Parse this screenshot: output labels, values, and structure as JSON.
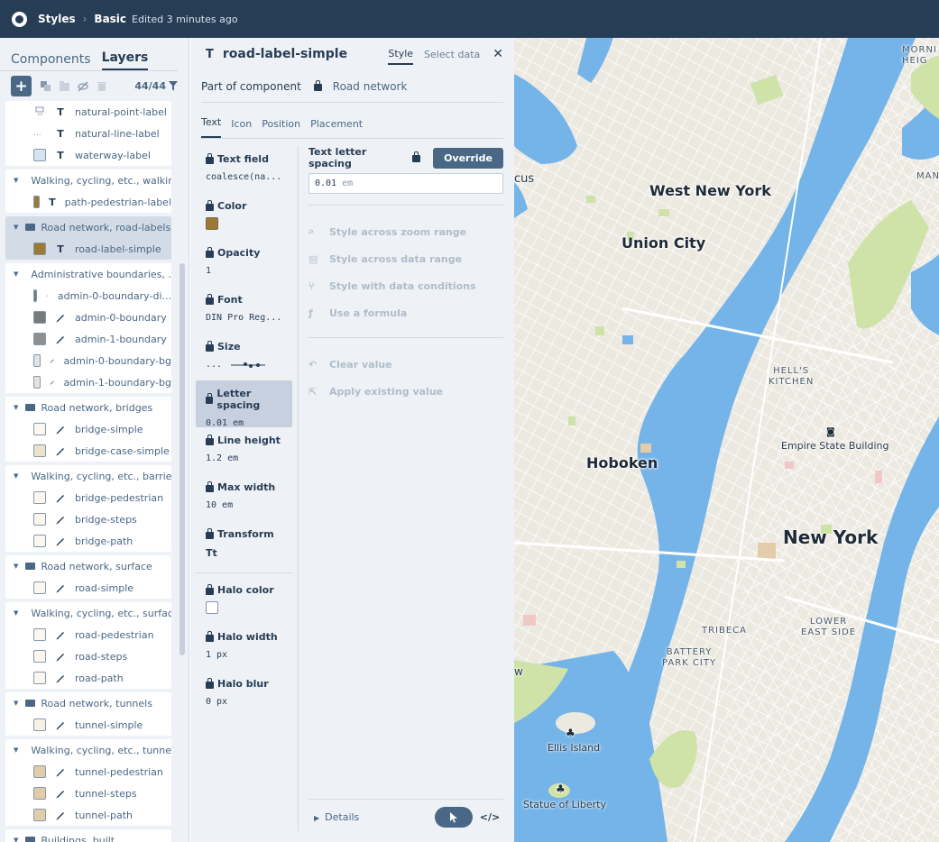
{
  "topbar": {
    "crumb_styles": "Styles",
    "crumb_style": "Basic",
    "edited": "Edited 3 minutes ago"
  },
  "left": {
    "tab_components": "Components",
    "tab_layers": "Layers",
    "count": "44/44",
    "items_top": [
      {
        "name": "natural-point-label",
        "icon": "text-icon"
      },
      {
        "name": "natural-line-label",
        "icon": "text-icon"
      },
      {
        "name": "waterway-label",
        "icon": "text-icon",
        "swatch": "#d6e4f1"
      }
    ],
    "groups": [
      {
        "name": "Walking, cycling, etc., walkin...",
        "layers": [
          {
            "name": "path-pedestrian-label",
            "swatch": "#9c7a33",
            "icon": "text-icon"
          }
        ]
      },
      {
        "name": "Road network, road-labels",
        "selected": true,
        "layers": [
          {
            "name": "road-label-simple",
            "swatch": "#9c7a33",
            "icon": "text-icon"
          }
        ]
      },
      {
        "name": "Administrative boundaries, ...",
        "layers": [
          {
            "name": "admin-0-boundary-di...",
            "swatch": "#7a7a7a",
            "icon": "pencil-icon"
          },
          {
            "name": "admin-0-boundary",
            "swatch": "#7a7a7a",
            "icon": "pencil-icon"
          },
          {
            "name": "admin-1-boundary",
            "swatch": "#8f8f8f",
            "icon": "pencil-icon"
          },
          {
            "name": "admin-0-boundary-bg",
            "swatch": "#e3e3e3",
            "icon": "pencil-icon"
          },
          {
            "name": "admin-1-boundary-bg",
            "swatch": "#e7e1d6",
            "icon": "pencil-icon"
          }
        ]
      },
      {
        "name": "Road network, bridges",
        "layers": [
          {
            "name": "bridge-simple",
            "swatch": "#fbf7ee",
            "icon": "pencil-icon"
          },
          {
            "name": "bridge-case-simple",
            "swatch": "#ede3cc",
            "icon": "pencil-icon"
          }
        ]
      },
      {
        "name": "Walking, cycling, etc., barrier...",
        "layers": [
          {
            "name": "bridge-pedestrian",
            "swatch": "#fbf7ee",
            "icon": "pencil-icon"
          },
          {
            "name": "bridge-steps",
            "swatch": "#fbf7ee",
            "icon": "pencil-icon"
          },
          {
            "name": "bridge-path",
            "swatch": "#fbf7ee",
            "icon": "pencil-icon"
          }
        ]
      },
      {
        "name": "Road network, surface",
        "layers": [
          {
            "name": "road-simple",
            "swatch": "#fbf7ee",
            "icon": "pencil-icon"
          }
        ]
      },
      {
        "name": "Walking, cycling, etc., surface",
        "layers": [
          {
            "name": "road-pedestrian",
            "swatch": "#fbf7ee",
            "icon": "pencil-icon"
          },
          {
            "name": "road-steps",
            "swatch": "#fbf7ee",
            "icon": "pencil-icon"
          },
          {
            "name": "road-path",
            "swatch": "#fbf7ee",
            "icon": "pencil-icon"
          }
        ]
      },
      {
        "name": "Road network, tunnels",
        "layers": [
          {
            "name": "tunnel-simple",
            "swatch": "#f8f1e3",
            "icon": "pencil-icon"
          }
        ]
      },
      {
        "name": "Walking, cycling, etc., tunnels",
        "layers": [
          {
            "name": "tunnel-pedestrian",
            "swatch": "#e2ccaa",
            "icon": "pencil-icon"
          },
          {
            "name": "tunnel-steps",
            "swatch": "#e2ccaa",
            "icon": "pencil-icon"
          },
          {
            "name": "tunnel-path",
            "swatch": "#e2ccaa",
            "icon": "pencil-icon"
          }
        ]
      },
      {
        "name": "Buildings, built",
        "layers": []
      }
    ]
  },
  "mid": {
    "layer_type": "T",
    "title": "road-label-simple",
    "tab_style": "Style",
    "tab_data": "Select data",
    "part_of": "Part of component",
    "component": "Road network",
    "tabs": [
      "Text",
      "Icon",
      "Position",
      "Placement"
    ],
    "props": [
      {
        "label": "Text field",
        "value": "coalesce(na..."
      },
      {
        "label": "Color",
        "swatch": "#9c7a33"
      },
      {
        "label": "Opacity",
        "value": "1"
      },
      {
        "label": "Font",
        "value": "DIN Pro Reg..."
      },
      {
        "label": "Size",
        "value": "..."
      },
      {
        "label": "Letter spacing",
        "value": "0.01 em",
        "selected": true
      },
      {
        "label": "Line height",
        "value": "1.2 em"
      },
      {
        "label": "Max width",
        "value": "10 em"
      },
      {
        "label": "Transform",
        "value": "Tt"
      },
      {
        "label": "Halo color",
        "swatch": "#ffffff"
      },
      {
        "label": "Halo width",
        "value": "1 px"
      },
      {
        "label": "Halo blur",
        "value": "0 px"
      }
    ],
    "editor": {
      "label": "Text letter spacing",
      "override": "Override",
      "value": "0.01",
      "unit": "em",
      "options": [
        "Style across zoom range",
        "Style across data range",
        "Style with data conditions",
        "Use a formula"
      ],
      "options2": [
        "Clear value",
        "Apply existing value"
      ]
    },
    "details": "Details",
    "code_label": "</>"
  },
  "map": {
    "labels": {
      "west_new_york": "West New York",
      "union_city": "Union City",
      "hoboken": "Hoboken",
      "new_york": "New York",
      "hells_kitchen_1": "HELL'S",
      "hells_kitchen_2": "KITCHEN",
      "empire": "Empire State Building",
      "tribeca": "TRIBECA",
      "battery_1": "BATTERY",
      "battery_2": "PARK CITY",
      "les_1": "LOWER",
      "les_2": "EAST SIDE",
      "ellis": "Ellis Island",
      "liberty": "Statue of Liberty",
      "cus": "cus",
      "morni_1": "MORNI",
      "morni_2": "HEIG",
      "man": "MAN",
      "w": "w"
    },
    "colors": {
      "water": "#75b4e8",
      "land": "#ece9e1",
      "park": "#cfe3a8",
      "road": "#ffffff"
    }
  }
}
